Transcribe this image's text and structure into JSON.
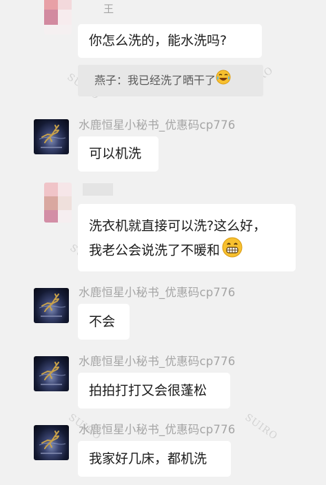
{
  "messages": [
    {
      "type": "incoming",
      "sender": "王",
      "avatar": "pixelated-avatar",
      "text": "你怎么洗的，能水洗吗?"
    },
    {
      "type": "quote",
      "text": "燕子：我已经洗了晒干了",
      "emoji": "laughing-tears-emoji"
    },
    {
      "type": "incoming",
      "sender": "水鹿恒星小秘书_优惠码cp776",
      "avatar": "deer-logo-avatar",
      "text": "可以机洗"
    },
    {
      "type": "incoming",
      "sender": "",
      "avatar": "pixelated-avatar",
      "lines": [
        "洗衣机就直接可以洗?这么好，",
        "我老公会说洗了不暖和"
      ],
      "emoji": "grinning-emoji"
    },
    {
      "type": "incoming",
      "sender": "水鹿恒星小秘书_优惠码cp776",
      "avatar": "deer-logo-avatar",
      "text": "不会"
    },
    {
      "type": "incoming",
      "sender": "水鹿恒星小秘书_优惠码cp776",
      "avatar": "deer-logo-avatar",
      "text": "拍拍打打又会很蓬松"
    },
    {
      "type": "incoming",
      "sender": "水鹿恒星小秘书_优惠码cp776",
      "avatar": "deer-logo-avatar",
      "text": "我家好几床，都机洗"
    }
  ],
  "watermark_text": "SUIRO",
  "colors": {
    "background": "#f1f1f1",
    "bubble": "#ffffff",
    "quote_bg": "#e7e7e7",
    "sender_name": "#a5a5a5",
    "deer_gold": "#c9a24a"
  }
}
